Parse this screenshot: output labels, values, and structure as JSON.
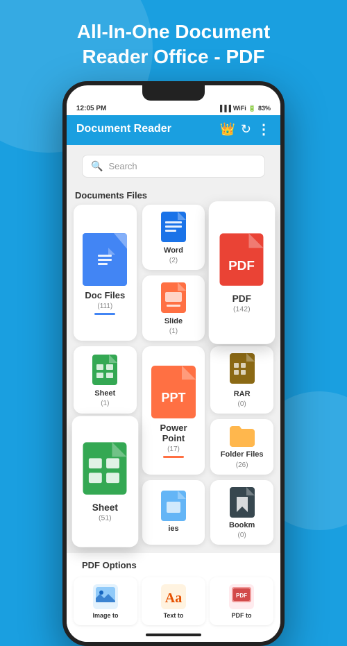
{
  "appTitle": "All-In-One Document\nReader Office - PDF",
  "statusBar": {
    "time": "12:05 PM",
    "battery": "83%"
  },
  "header": {
    "title": "Document Reader",
    "crownIcon": "👑",
    "refreshLabel": "↻",
    "moreLabel": "⋮"
  },
  "search": {
    "placeholder": "Search"
  },
  "documentsSection": {
    "title": "Documents Files",
    "cards": [
      {
        "name": "Doc Files",
        "count": "(111)",
        "type": "doc",
        "color": "blue",
        "size": "large"
      },
      {
        "name": "Word",
        "count": "(2)",
        "type": "word",
        "color": "dark-blue"
      },
      {
        "name": "PDF",
        "count": "(142)",
        "type": "pdf",
        "color": "red",
        "elevated": true
      },
      {
        "name": "Slide",
        "count": "(1)",
        "type": "slide",
        "color": "orange-slide"
      },
      {
        "name": "Sheet",
        "count": "(1)",
        "type": "sheet",
        "color": "green"
      },
      {
        "name": "Power Point",
        "count": "(17)",
        "type": "ppt",
        "color": "orange",
        "size": "large"
      },
      {
        "name": "RAR",
        "count": "(0)",
        "type": "rar",
        "color": "gold"
      },
      {
        "name": "Sheet",
        "count": "(51)",
        "type": "sheet2",
        "color": "green",
        "elevated": true
      },
      {
        "name": "Folder Files",
        "count": "(26)",
        "type": "folder"
      },
      {
        "name": "ies",
        "count": "",
        "type": "ies"
      },
      {
        "name": "Bookm",
        "count": "(0)",
        "type": "bookmark"
      }
    ]
  },
  "pdfOptions": {
    "title": "PDF Options",
    "items": [
      {
        "name": "Image to",
        "icon": "image"
      },
      {
        "name": "Text to",
        "icon": "text"
      },
      {
        "name": "PDF to",
        "icon": "pdf-convert"
      }
    ]
  }
}
